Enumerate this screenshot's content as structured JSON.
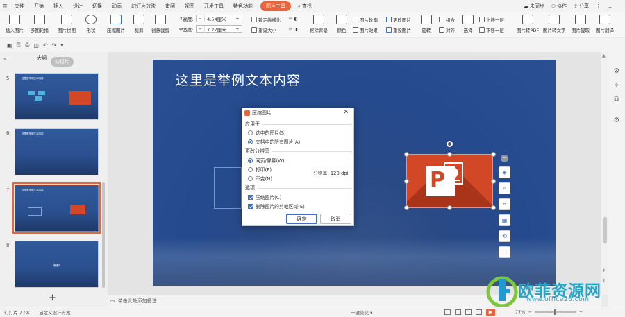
{
  "menu": {
    "items": [
      "文件",
      "开始",
      "插入",
      "设计",
      "切换",
      "动画",
      "幻灯片放映",
      "审阅",
      "视图",
      "开发工具",
      "特色功能"
    ],
    "active": "图片工具",
    "search": "查找",
    "sync": "未同步",
    "collab": "协作",
    "share": "分享"
  },
  "ribbon": {
    "insert_image": "插入图片",
    "multi_crop": "多图轮播",
    "image_collage": "图片拼图",
    "shape": "形状",
    "compress": "压缩图片",
    "crop": "裁剪",
    "creative_crop": "创意裁剪",
    "height_label": "高度:",
    "height_value": "4.54厘米",
    "width_label": "宽度:",
    "width_value": "7.27厘米",
    "lock_ratio": "锁定纵横比",
    "reset_size": "重设大小",
    "remove_bg": "抠除背景",
    "color": "颜色",
    "outline": "图片轮廓",
    "effect": "图片效果",
    "change_image": "更改图片",
    "reset_image": "重设图片",
    "rotate": "旋转",
    "group": "组合",
    "align": "对齐",
    "select": "选择",
    "bring_forward": "上移一层",
    "send_backward": "下移一层",
    "to_pdf": "图片转PDF",
    "to_text": "图片转文字",
    "extract": "图片提取",
    "translate": "图片翻译"
  },
  "left_panel": {
    "tab_outline": "大纲",
    "tab_slides": "幻灯片",
    "slides": [
      {
        "num": "5",
        "title": "这里是举例文本内容"
      },
      {
        "num": "6",
        "title": "这里是举例文本内容"
      },
      {
        "num": "7",
        "title": "这里是举例文本内容"
      },
      {
        "num": "8",
        "title": "谢谢!"
      }
    ]
  },
  "slide": {
    "title": "这里是举例文本内容"
  },
  "dialog": {
    "title": "压缩图片",
    "apply_to": "应用于",
    "opt_selected": "选中的图片(S)",
    "opt_all": "文档中的所有图片(A)",
    "change_res": "更改分辨率",
    "opt_web": "网页/屏幕(W)",
    "opt_print": "打印(P)",
    "opt_nochange": "不变(N)",
    "resolution": "分辨率: 120 dpi",
    "options": "选项",
    "chk_compress": "压缩图片(C)",
    "chk_delete_crop": "删除图片的剪裁区域(E)",
    "ok": "确定",
    "cancel": "取消"
  },
  "notes": "单击此处添加备注",
  "status": {
    "slide_count": "幻灯片 7 / 8",
    "design": "自定义设计方案",
    "beautify": "一键美化",
    "zoom": "77%"
  },
  "watermark": {
    "name": "欧菲资源网",
    "url": "www.office26.com"
  },
  "colors": {
    "accent": "#e8643c",
    "ppt_red": "#d24726",
    "selection_blue": "#3a6fc4"
  }
}
